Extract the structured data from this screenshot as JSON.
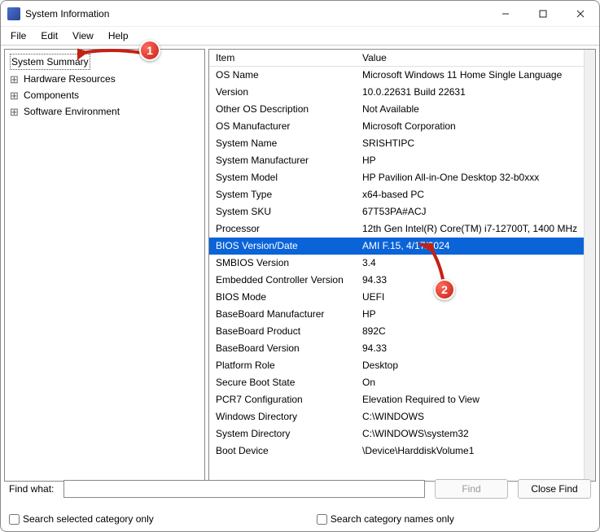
{
  "window": {
    "title": "System Information"
  },
  "menu": {
    "file": "File",
    "edit": "Edit",
    "view": "View",
    "help": "Help"
  },
  "tree": {
    "summary": "System Summary",
    "hardware": "Hardware Resources",
    "components": "Components",
    "software": "Software Environment"
  },
  "columns": {
    "item": "Item",
    "value": "Value"
  },
  "rows": [
    {
      "item": "OS Name",
      "value": "Microsoft Windows 11 Home Single Language"
    },
    {
      "item": "Version",
      "value": "10.0.22631 Build 22631"
    },
    {
      "item": "Other OS Description",
      "value": "Not Available"
    },
    {
      "item": "OS Manufacturer",
      "value": "Microsoft Corporation"
    },
    {
      "item": "System Name",
      "value": "SRISHTIPC"
    },
    {
      "item": "System Manufacturer",
      "value": "HP"
    },
    {
      "item": "System Model",
      "value": "HP Pavilion All-in-One Desktop 32-b0xxx"
    },
    {
      "item": "System Type",
      "value": "x64-based PC"
    },
    {
      "item": "System SKU",
      "value": "67T53PA#ACJ"
    },
    {
      "item": "Processor",
      "value": "12th Gen Intel(R) Core(TM) i7-12700T, 1400 MHz"
    },
    {
      "item": "BIOS Version/Date",
      "value": "AMI F.15, 4/17/2024",
      "selected": true
    },
    {
      "item": "SMBIOS Version",
      "value": "3.4"
    },
    {
      "item": "Embedded Controller Version",
      "value": "94.33"
    },
    {
      "item": "BIOS Mode",
      "value": "UEFI"
    },
    {
      "item": "BaseBoard Manufacturer",
      "value": "HP"
    },
    {
      "item": "BaseBoard Product",
      "value": "892C"
    },
    {
      "item": "BaseBoard Version",
      "value": "94.33"
    },
    {
      "item": "Platform Role",
      "value": "Desktop"
    },
    {
      "item": "Secure Boot State",
      "value": "On"
    },
    {
      "item": "PCR7 Configuration",
      "value": "Elevation Required to View"
    },
    {
      "item": "Windows Directory",
      "value": "C:\\WINDOWS"
    },
    {
      "item": "System Directory",
      "value": "C:\\WINDOWS\\system32"
    },
    {
      "item": "Boot Device",
      "value": "\\Device\\HarddiskVolume1"
    }
  ],
  "footer": {
    "find_label": "Find what:",
    "find_value": "",
    "find_btn": "Find",
    "close_btn": "Close Find",
    "check1": "Search selected category only",
    "check2": "Search category names only"
  },
  "annotations": {
    "one": "1",
    "two": "2"
  }
}
